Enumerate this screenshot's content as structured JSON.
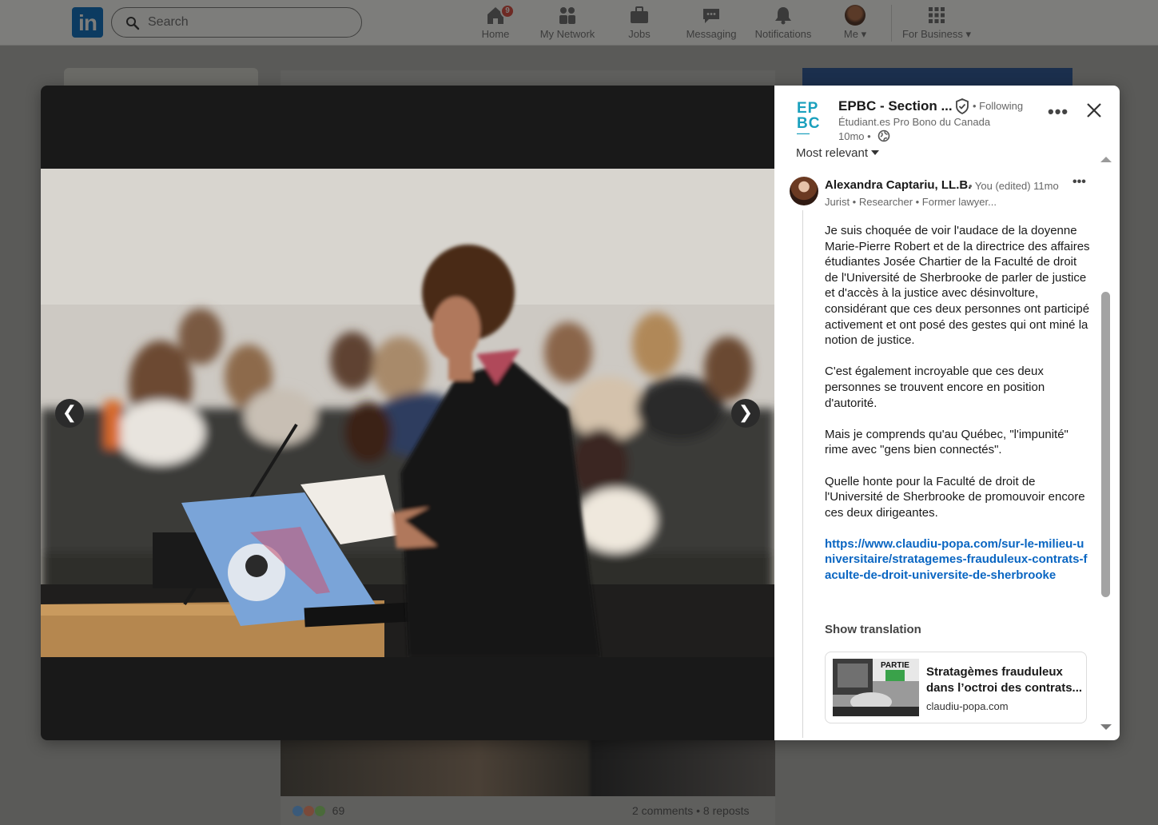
{
  "topnav": {
    "logo_text": "in",
    "search_placeholder": "Search",
    "items": [
      {
        "label": "Home",
        "icon": "home-icon",
        "badge": "9"
      },
      {
        "label": "My Network",
        "icon": "network-icon"
      },
      {
        "label": "Jobs",
        "icon": "briefcase-icon"
      },
      {
        "label": "Messaging",
        "icon": "messaging-icon"
      },
      {
        "label": "Notifications",
        "icon": "bell-icon"
      },
      {
        "label": "Me",
        "icon": "avatar"
      },
      {
        "label": "For Business",
        "icon": "grid-icon"
      }
    ]
  },
  "background_post": {
    "reaction_count": "69",
    "stats": "2 comments • 8 reposts"
  },
  "modal": {
    "photo_alt": "",
    "prev_label": "❮",
    "next_label": "❯",
    "org": {
      "logo_line1": "EP",
      "logo_line2": "BC",
      "name": "EPBC - Section ...",
      "following": "• Following",
      "subtitle": "Étudiant.es Pro Bono du Canada",
      "time": "10mo •"
    },
    "more_label": "•••",
    "sort_label": "Most relevant",
    "comment": {
      "author": "Alexandra Captariu, LL.B.",
      "meta": "• You (edited) 11mo",
      "more_label": "•••",
      "headline": "Jurist • Researcher • Former lawyer...",
      "paragraphs": [
        "Je suis choquée de voir l'audace de la doyenne Marie-Pierre Robert et de la directrice des affaires étudiantes Josée Chartier de la Faculté de droit de l'Université de Sherbrooke de parler de justice et d'accès à la justice avec désinvolture, considérant que ces deux personnes ont participé activement et ont posé des gestes qui ont miné la notion de justice.",
        "C'est également incroyable que ces deux personnes se trouvent encore en position d'autorité.",
        "Mais je comprends qu'au Québec, \"l'impunité\" rime avec \"gens bien connectés\".",
        "Quelle honte pour la Faculté de droit de l'Université de Sherbrooke de promouvoir encore ces deux dirigeantes."
      ],
      "link": "https://www.claudiu-popa.com/sur-le-milieu-universitaire/stratagemes-frauduleux-contrats-faculte-de-droit-universite-de-sherbrooke",
      "show_translation": "Show translation",
      "link_card": {
        "title": "Stratagèmes frauduleux dans l’octroi des contrats...",
        "domain": "claudiu-popa.com",
        "thumb_label": "PARTIE"
      }
    }
  },
  "colors": {
    "accent": "#0a66c2",
    "epbc": "#1aa0bd",
    "overlay": "#5a5a58",
    "viewer_bg": "#191919"
  }
}
